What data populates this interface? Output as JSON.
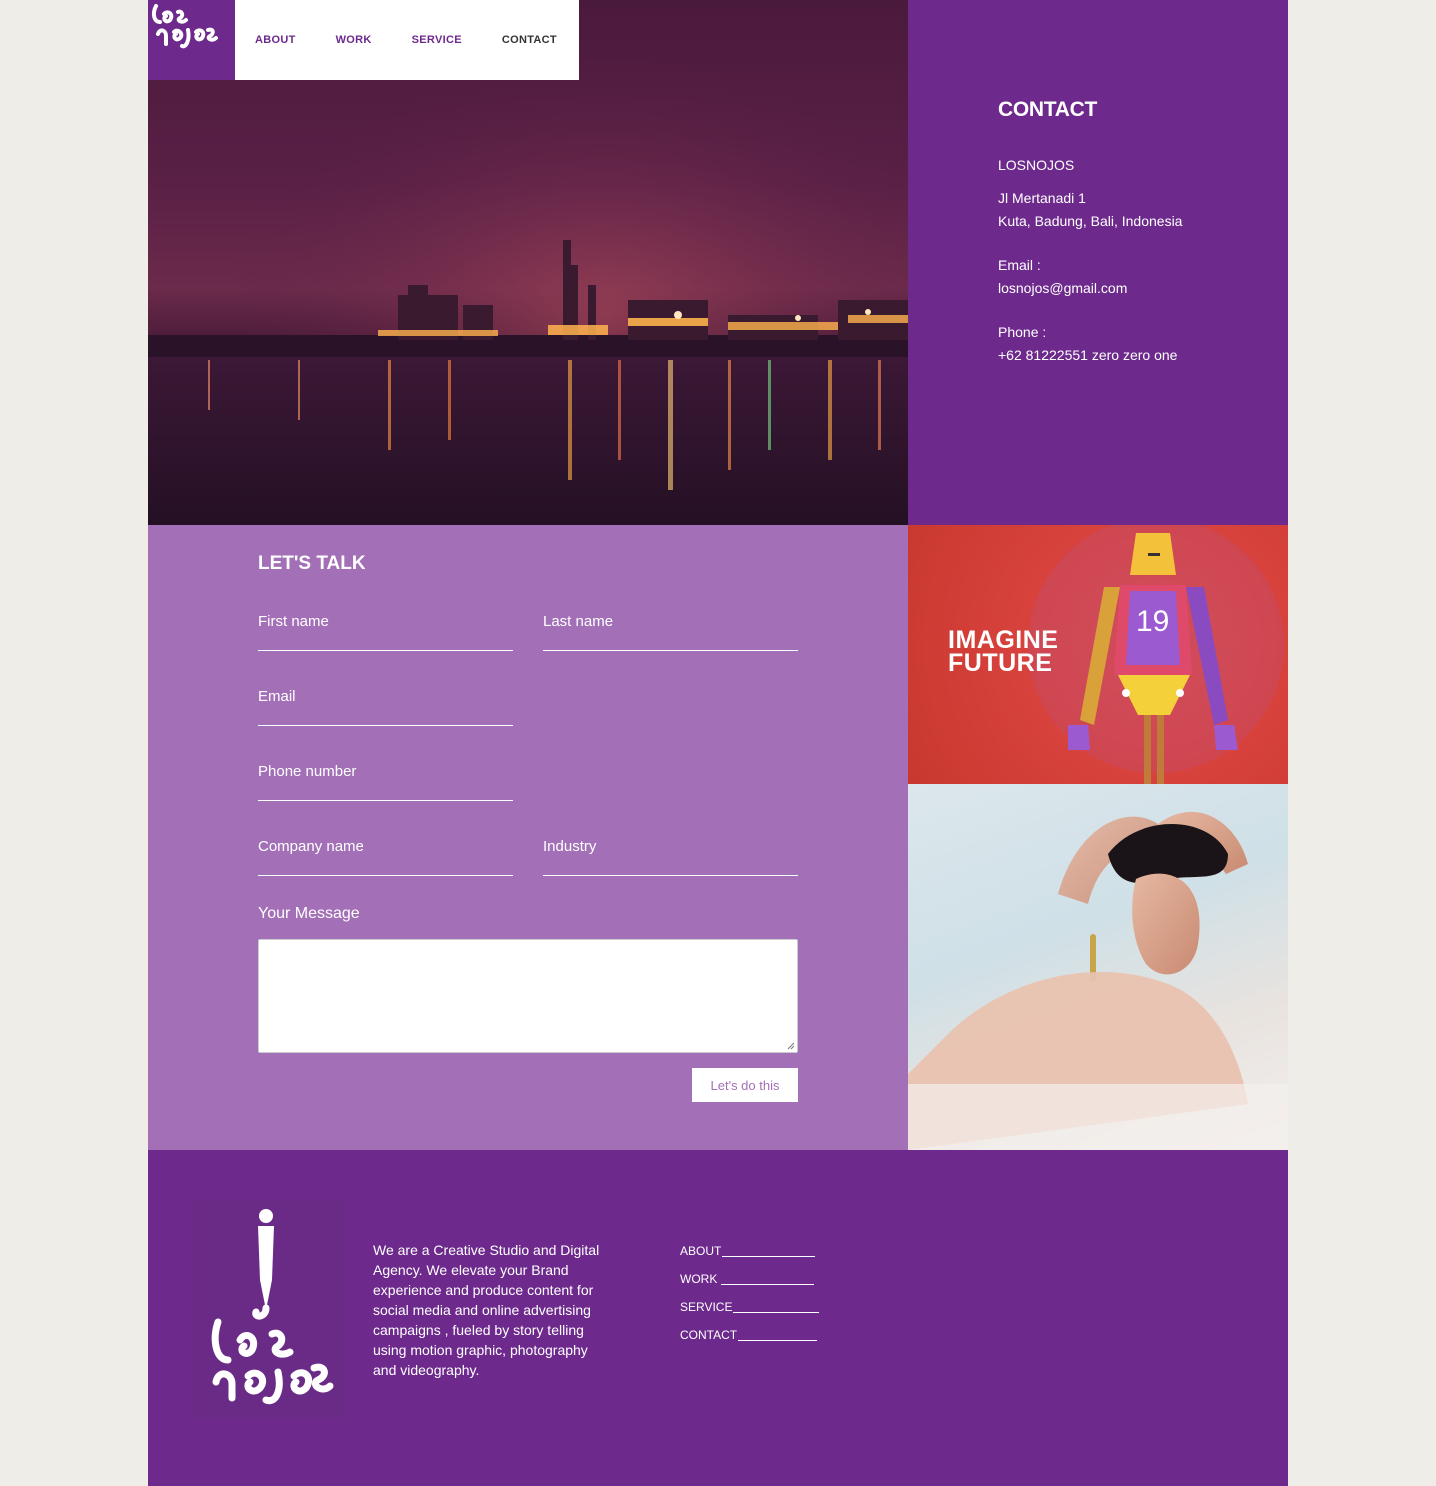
{
  "nav": {
    "logo_alt": "los nojos",
    "items": [
      {
        "label": "ABOUT"
      },
      {
        "label": "WORK"
      },
      {
        "label": "SERVICE"
      },
      {
        "label": "CONTACT"
      }
    ]
  },
  "contact": {
    "title": "CONTACT",
    "company": "LOSNOJOS",
    "address_line1": "Jl Mertanadi 1",
    "address_line2": "Kuta, Badung, Bali, Indonesia",
    "email_label": "Email :",
    "email": "losnojos@gmail.com",
    "phone_label": "Phone :",
    "phone": "+62 81222551 zero zero one"
  },
  "form": {
    "title": "LET'S TALK",
    "first_name": "First name",
    "last_name": "Last name",
    "email": "Email",
    "phone": "Phone number",
    "company": "Company name",
    "industry": "Industry",
    "message_label": "Your Message",
    "submit": "Let's do this"
  },
  "poster": {
    "headline_line1": "IMAGINE",
    "headline_line2": "FUTURE",
    "number": "19"
  },
  "footer": {
    "about": "We are a Creative Studio and Digital Agency. We elevate your Brand experience and produce content for social media and online advertising campaigns , fueled by story telling using motion graphic, photography and videography.",
    "links": [
      {
        "label": "ABOUT"
      },
      {
        "label": "WORK"
      },
      {
        "label": "SERVICE"
      },
      {
        "label": "CONTACT"
      }
    ]
  },
  "colors": {
    "brand_purple": "#6d2a8c",
    "form_lilac": "#a370b8",
    "page_bg": "#eeede8"
  }
}
